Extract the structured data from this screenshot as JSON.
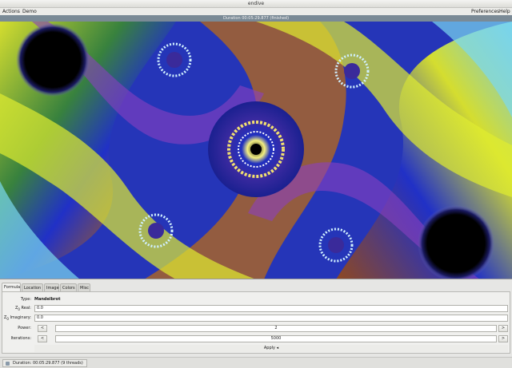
{
  "window": {
    "title": "endive"
  },
  "menu": {
    "actions": "Actions",
    "demo": "Demo",
    "preferences": "Preferences",
    "help": "Help"
  },
  "render_status": "Duration 00:05:29.877 (finished)",
  "tabs": [
    {
      "label": "Formula",
      "active": true
    },
    {
      "label": "Location",
      "active": false
    },
    {
      "label": "Image",
      "active": false
    },
    {
      "label": "Colors",
      "active": false
    },
    {
      "label": "Misc",
      "active": false
    }
  ],
  "formula": {
    "type_label": "Type:",
    "type_value": "Mandelbrot",
    "z0_real_label_main": "Z",
    "z0_real_label_sub": "0",
    "z0_real_label_rest": " Real:",
    "z0_real_value": "0.0",
    "z0_imag_label_main": "Z",
    "z0_imag_label_sub": "0",
    "z0_imag_label_rest": " Imaginary:",
    "z0_imag_value": "0.0",
    "power_label": "Power:",
    "power_value": "2",
    "iterations_label": "Iterations:",
    "iterations_value": "5000",
    "decrement": "<",
    "increment": ">",
    "apply_label": "Apply ◂"
  },
  "statusbar": {
    "text": "Duration: 00:05:29.877 (9 threads)"
  },
  "colors": {
    "fractal_deep_blue": "#1d2bb0",
    "fractal_yellow": "#e8f020",
    "fractal_orange": "#b06010",
    "fractal_cyan": "#7ad8f0"
  }
}
